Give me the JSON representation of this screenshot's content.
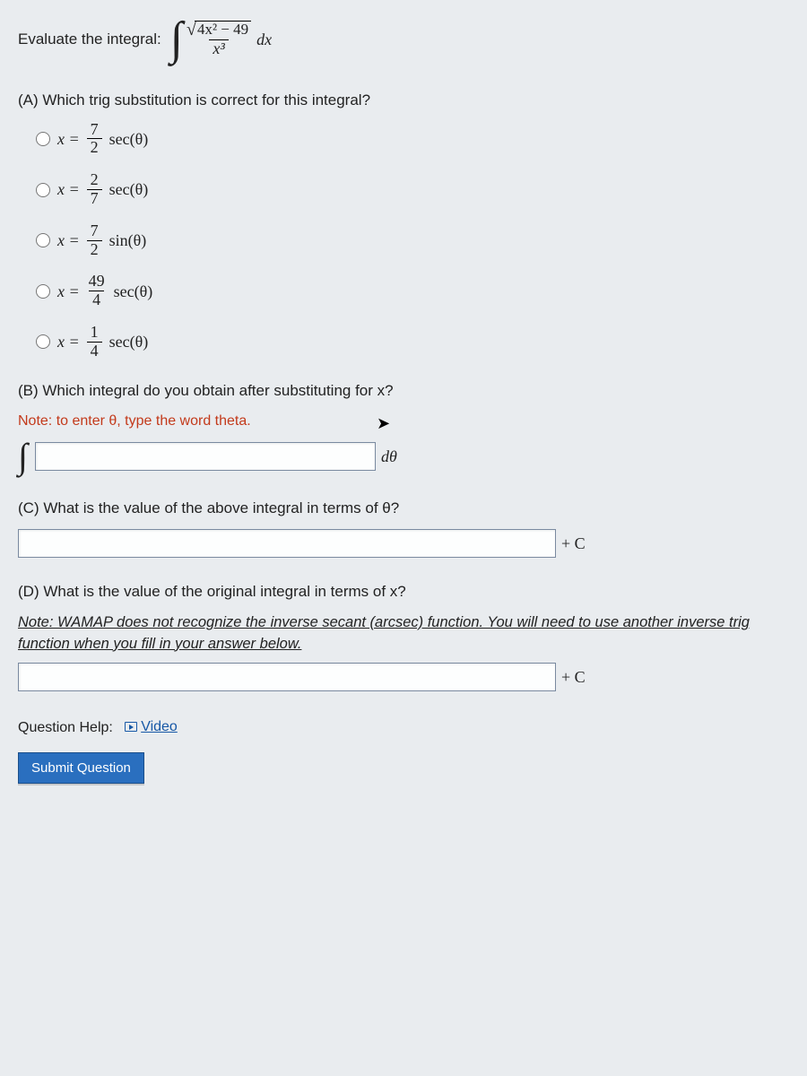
{
  "prompt_label": "Evaluate the integral:",
  "integral": {
    "numerator_sqrt_inner": "4x² − 49",
    "denominator": "x³",
    "dx": "dx"
  },
  "partA": {
    "question": "(A) Which trig substitution is correct for this integral?",
    "options": [
      {
        "frac_num": "7",
        "frac_den": "2",
        "func": "sec(θ)"
      },
      {
        "frac_num": "2",
        "frac_den": "7",
        "func": "sec(θ)"
      },
      {
        "frac_num": "7",
        "frac_den": "2",
        "func": "sin(θ)"
      },
      {
        "frac_num": "49",
        "frac_den": "4",
        "func": "sec(θ)"
      },
      {
        "frac_num": "1",
        "frac_den": "4",
        "func": "sec(θ)"
      }
    ],
    "lead": "x ="
  },
  "partB": {
    "question": "(B) Which integral do you obtain after substituting for x?",
    "note": "Note: to enter θ, type the word theta.",
    "dtheta": "dθ"
  },
  "partC": {
    "question": "(C) What is the value of the above integral in terms of θ?",
    "plusC": "+ C"
  },
  "partD": {
    "question": "(D) What is the value of the original integral in terms of x?",
    "note": "Note: WAMAP does not recognize the inverse secant (arcsec) function. You will need to use another inverse trig function when you fill in your answer below.",
    "plusC": "+ C"
  },
  "help": {
    "label": "Question Help:",
    "video": "Video"
  },
  "submit": "Submit Question"
}
